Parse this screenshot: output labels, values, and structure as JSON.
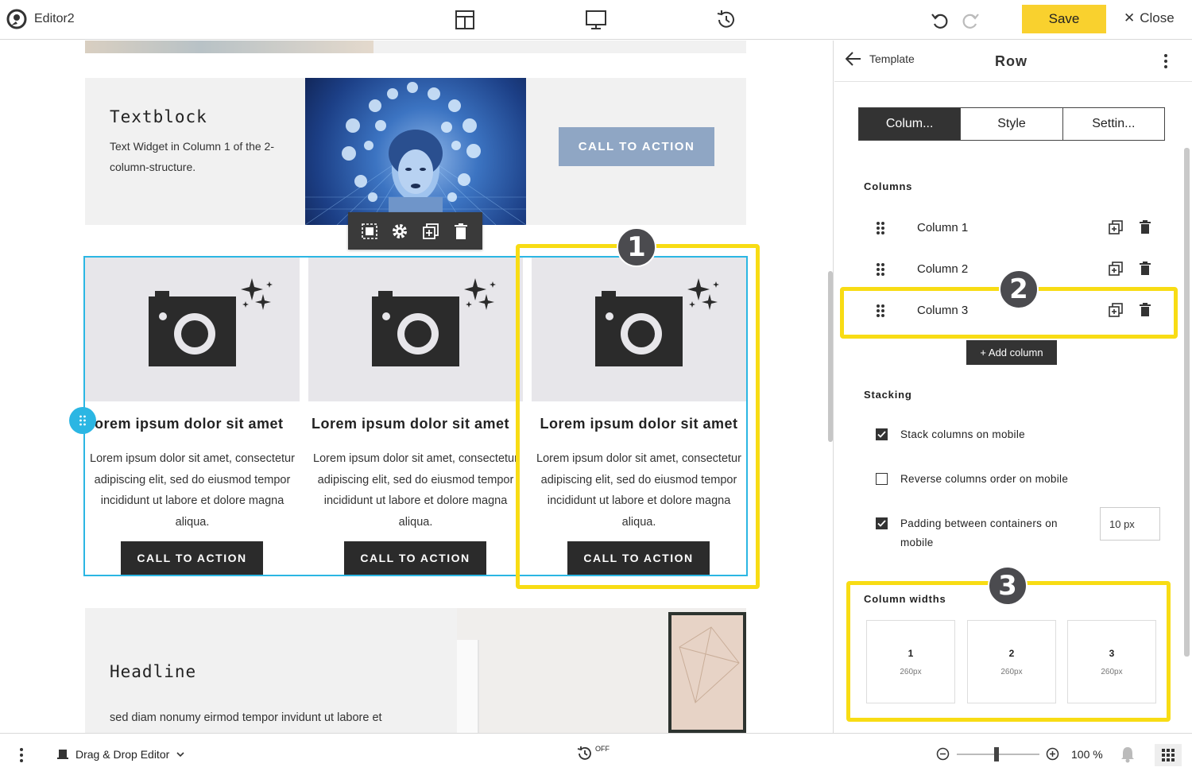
{
  "topbar": {
    "app_title": "Editor2",
    "icons": [
      "layout-icon",
      "desktop-preview-icon",
      "history-icon",
      "undo-icon",
      "redo-icon"
    ],
    "save_label": "Save",
    "close_label": "Close"
  },
  "canvas": {
    "row1": {
      "title": "Textblock",
      "text": "Text Widget in Column 1 of the 2-column-structure.",
      "cta": "CALL TO ACTION"
    },
    "columns": [
      {
        "heading": "Lorem ipsum dolor sit amet",
        "body": "Lorem ipsum dolor sit amet, consectetur adipiscing elit, sed do eiusmod tempor incididunt ut labore et dolore magna aliqua.",
        "cta": "CALL TO ACTION"
      },
      {
        "heading": "Lorem ipsum dolor sit amet",
        "body": "Lorem ipsum dolor sit amet, consectetur adipiscing elit, sed do eiusmod tempor incididunt ut labore et dolore magna aliqua.",
        "cta": "CALL TO ACTION"
      },
      {
        "heading": "Lorem ipsum dolor sit amet",
        "body": "Lorem ipsum dolor sit amet, consectetur adipiscing elit, sed do eiusmod tempor incididunt ut labore et dolore magna aliqua.",
        "cta": "CALL TO ACTION"
      }
    ],
    "row3": {
      "headline": "Headline",
      "text": "sed diam nonumy eirmod tempor invidunt ut labore et"
    }
  },
  "callouts": {
    "one": "1",
    "two": "2",
    "three": "3"
  },
  "panel": {
    "back_label": "Template",
    "title": "Row",
    "tabs": [
      {
        "label": "Colum...",
        "active": true
      },
      {
        "label": "Style",
        "active": false
      },
      {
        "label": "Settin...",
        "active": false
      }
    ],
    "columns_label": "Columns",
    "columns": [
      {
        "name": "Column 1"
      },
      {
        "name": "Column 2"
      },
      {
        "name": "Column 3"
      }
    ],
    "add_column_label": "+ Add column",
    "stacking_label": "Stacking",
    "options": [
      {
        "label": "Stack columns on mobile",
        "checked": true
      },
      {
        "label": "Reverse columns order on mobile",
        "checked": false
      },
      {
        "label": "Padding between containers on mobile",
        "checked": true
      }
    ],
    "padding_value": "10 px",
    "widths_label": "Column widths",
    "widths": [
      {
        "n": "1",
        "px": "260px"
      },
      {
        "n": "2",
        "px": "260px"
      },
      {
        "n": "3",
        "px": "260px"
      }
    ]
  },
  "bottombar": {
    "editor_mode": "Drag & Drop Editor",
    "timer_state": "OFF",
    "zoom": "100 %"
  },
  "colors": {
    "accent_yellow": "#f9d12e",
    "callout_yellow": "#f8dc14",
    "selection_blue": "#2bb6e3",
    "dark": "#333333"
  }
}
